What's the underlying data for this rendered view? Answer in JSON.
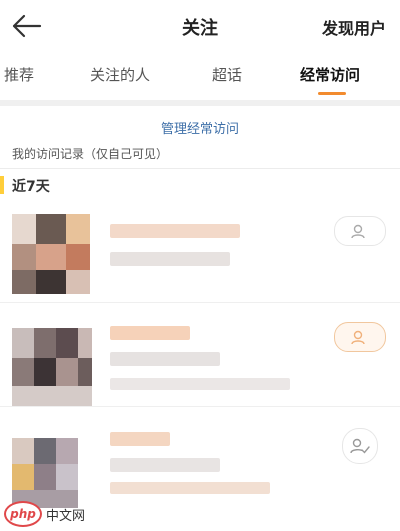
{
  "header": {
    "title": "关注",
    "right_action": "发现用户",
    "back_icon": "arrow-left-icon"
  },
  "tabs": [
    {
      "label": "推荐",
      "active": false
    },
    {
      "label": "关注的人",
      "active": false
    },
    {
      "label": "超话",
      "active": false
    },
    {
      "label": "经常访问",
      "active": true
    }
  ],
  "colors": {
    "accent": "#f28b2e",
    "link": "#3e6fa8",
    "section_bar": "#ffce3a"
  },
  "manage_link": "管理经常访问",
  "records_label": "我的访问记录（仅自己可见）",
  "section_label": "近7天",
  "items": [
    {
      "name": "",
      "subtitle": "",
      "action_icon": "follow-add-icon"
    },
    {
      "name": "",
      "subtitle": "",
      "action_icon": "follow-add-icon"
    },
    {
      "name": "",
      "subtitle": "",
      "action_icon": "followed-icon"
    }
  ],
  "watermark": {
    "logo": "php",
    "text": "中文网"
  }
}
